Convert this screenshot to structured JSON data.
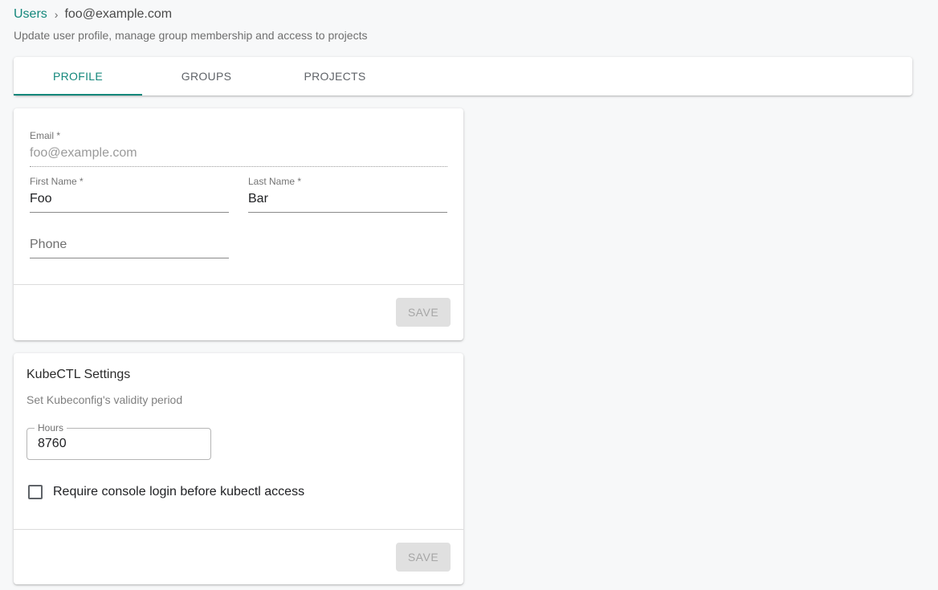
{
  "breadcrumb": {
    "root": "Users",
    "separator": "›",
    "current": "foo@example.com"
  },
  "subtitle": "Update user profile, manage group membership and access to projects",
  "tabs": [
    {
      "label": "PROFILE",
      "active": true
    },
    {
      "label": "GROUPS",
      "active": false
    },
    {
      "label": "PROJECTS",
      "active": false
    }
  ],
  "profile": {
    "email": {
      "label": "Email *",
      "value": "foo@example.com",
      "disabled": true
    },
    "first_name": {
      "label": "First Name *",
      "value": "Foo"
    },
    "last_name": {
      "label": "Last Name *",
      "value": "Bar"
    },
    "phone": {
      "placeholder": "Phone",
      "value": ""
    },
    "save_label": "SAVE",
    "save_disabled": true
  },
  "kubectl": {
    "title": "KubeCTL Settings",
    "subtitle": "Set Kubeconfig's validity period",
    "hours": {
      "label": "Hours",
      "value": "8760"
    },
    "require_login": {
      "label": "Require console login before kubectl access",
      "checked": false
    },
    "save_label": "SAVE",
    "save_disabled": true
  },
  "colors": {
    "accent": "#13877b",
    "background": "#f7f8f9",
    "disabled_button": "#e0e0e0"
  }
}
